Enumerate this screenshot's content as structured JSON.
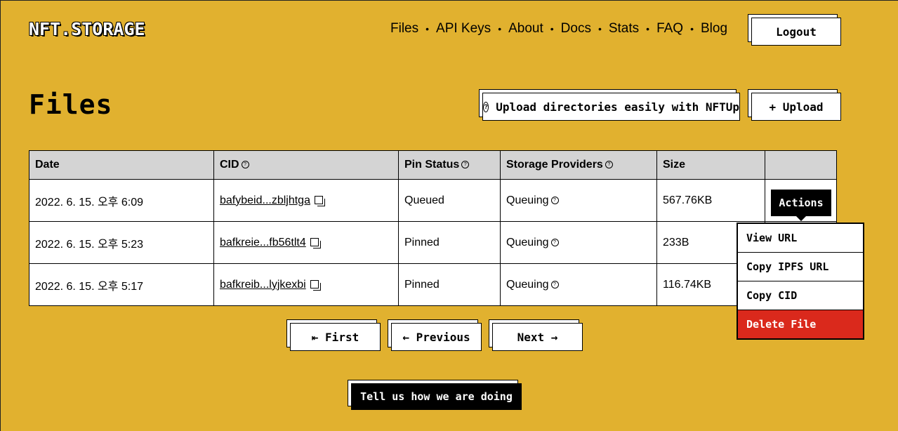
{
  "header": {
    "logo": "NFT.STORAGE",
    "nav": [
      "Files",
      "API Keys",
      "About",
      "Docs",
      "Stats",
      "FAQ",
      "Blog"
    ],
    "separator": "•",
    "logout_label": "Logout"
  },
  "page": {
    "title": "Files",
    "nftup_label": "Upload directories easily with NFTUp",
    "upload_label": "+ Upload"
  },
  "table": {
    "columns": [
      "Date",
      "CID",
      "Pin Status",
      "Storage Providers",
      "Size",
      ""
    ],
    "rows": [
      {
        "date": "2022. 6. 15. 오후 6:09",
        "cid": "bafybeid...zbljhtga",
        "pin_status": "Queued",
        "providers": "Queuing",
        "size": "567.76KB"
      },
      {
        "date": "2022. 6. 15. 오후 5:23",
        "cid": "bafkreie...fb56tlt4",
        "pin_status": "Pinned",
        "providers": "Queuing",
        "size": "233B"
      },
      {
        "date": "2022. 6. 15. 오후 5:17",
        "cid": "bafkreib...lyjkexbi",
        "pin_status": "Pinned",
        "providers": "Queuing",
        "size": "116.74KB"
      }
    ],
    "actions_label": "Actions"
  },
  "actions_menu": [
    "View URL",
    "Copy IPFS URL",
    "Copy CID",
    "Delete File"
  ],
  "pagination": {
    "first": "⇤ First",
    "previous": "← Previous",
    "next": "Next →"
  },
  "feedback_label": "Tell us how we are doing",
  "colors": {
    "background": "#e1b12f",
    "danger": "#da291c"
  }
}
